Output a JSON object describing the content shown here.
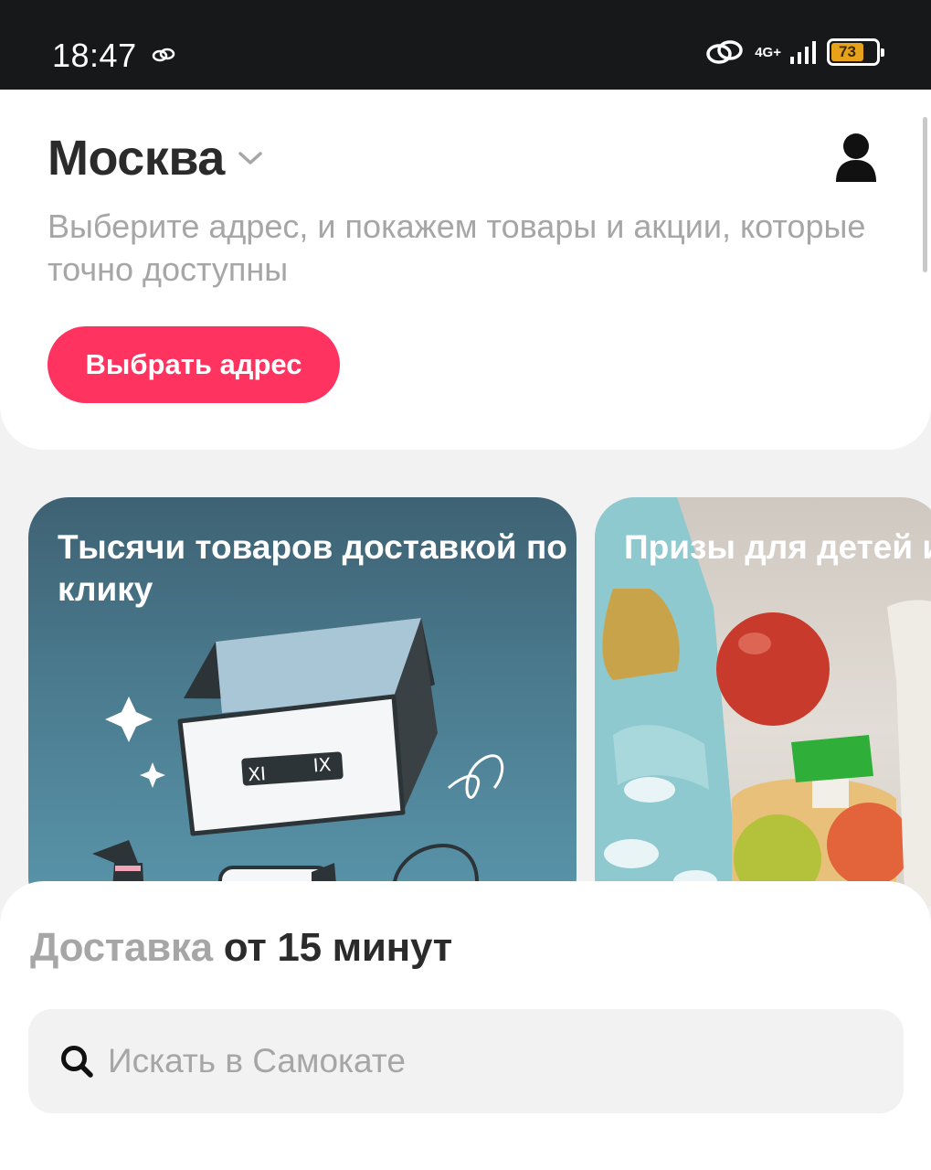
{
  "status_bar": {
    "time": "18:47",
    "network": "4G+",
    "battery_level": 73,
    "battery_text": "73",
    "battery_color": "#e8a21a"
  },
  "header": {
    "city": "Москва",
    "address_hint": "Выберите адрес, и покажем товары и акции, которые точно доступны",
    "pick_address_label": "Выбрать адрес"
  },
  "promos": [
    {
      "title": "Тысячи товаров доставкой по клику"
    },
    {
      "title": "Призы для детей игре"
    }
  ],
  "sheet": {
    "delivery_light": "Доставка",
    "delivery_dark": "от 15 минут",
    "search_placeholder": "Искать в Самокате"
  },
  "colors": {
    "accent": "#ff335f",
    "promo_teal": "#4b7b8f",
    "text_dark": "#2b2b2b",
    "text_muted": "#a6a6a6"
  },
  "icons": [
    "link-icon",
    "hotspot-icon",
    "signal-icon",
    "battery-icon",
    "chevron-down-icon",
    "profile-icon",
    "search-icon"
  ]
}
